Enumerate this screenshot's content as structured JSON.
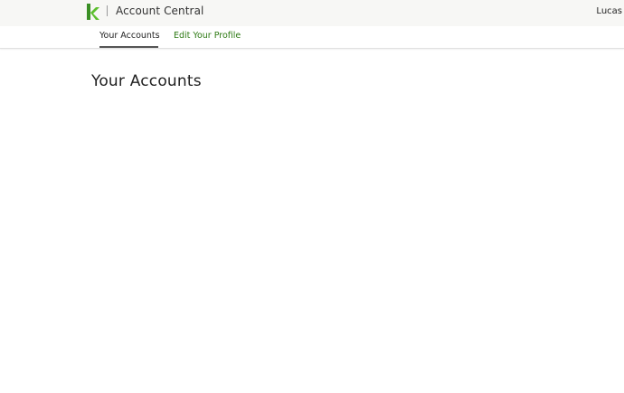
{
  "header": {
    "app_title": "Account Central",
    "user_name": "Lucas",
    "logo_icon": "k-logo-icon",
    "brand_color": "#4caf2a"
  },
  "tabs": [
    {
      "label": "Your Accounts",
      "active": true
    },
    {
      "label": "Edit Your Profile",
      "active": false
    }
  ],
  "main": {
    "page_title": "Your Accounts"
  },
  "colors": {
    "link_green": "#2e7a14",
    "active_underline": "#555555",
    "topbar_bg": "#f7f7f5"
  }
}
